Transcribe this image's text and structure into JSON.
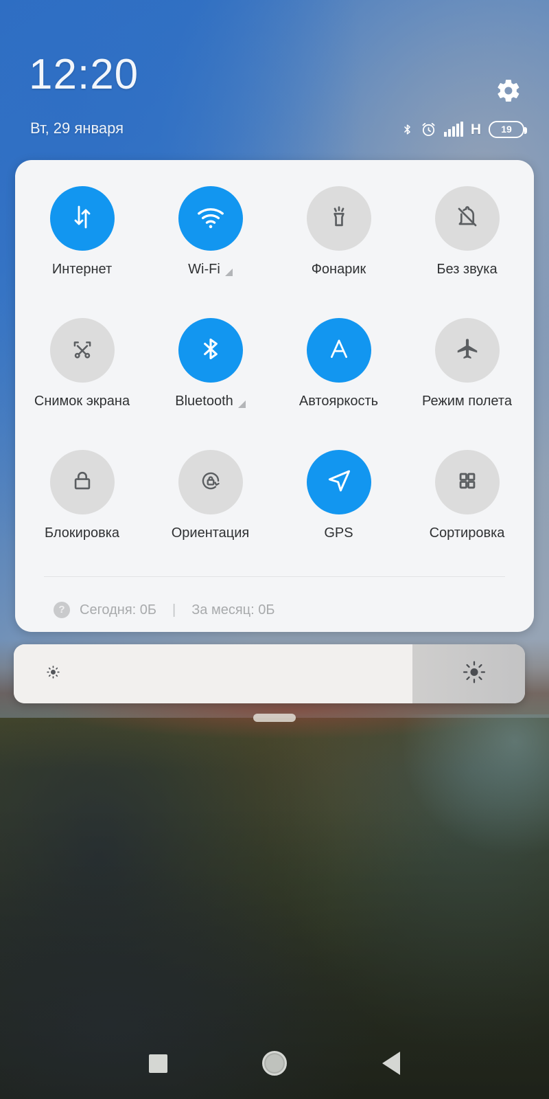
{
  "header": {
    "clock": "12:20",
    "date": "Вт, 29 января",
    "settings_icon": "gear-icon",
    "statusbar": {
      "bluetooth_icon": "bluetooth-icon",
      "alarm_icon": "alarm-clock-icon",
      "signal_icon": "signal-bars-icon",
      "network_type": "H",
      "battery_level": "19"
    }
  },
  "quick_settings": {
    "tiles": [
      {
        "label": "Интернет",
        "icon": "mobile-data-icon",
        "state": "on"
      },
      {
        "label": "Wi-Fi",
        "icon": "wifi-icon",
        "state": "on",
        "expander": true
      },
      {
        "label": "Фонарик",
        "icon": "flashlight-icon",
        "state": "off"
      },
      {
        "label": "Без звука",
        "icon": "bell-off-icon",
        "state": "off"
      },
      {
        "label": "Снимок экрана",
        "icon": "screenshot-icon",
        "state": "off"
      },
      {
        "label": "Bluetooth",
        "icon": "bluetooth-icon",
        "state": "on",
        "expander": true
      },
      {
        "label": "Автояркость",
        "icon": "auto-brightness-icon",
        "state": "on"
      },
      {
        "label": "Режим полета",
        "icon": "airplane-icon",
        "state": "off"
      },
      {
        "label": "Блокировка",
        "icon": "lock-icon",
        "state": "off"
      },
      {
        "label": "Ориентация",
        "icon": "rotation-lock-icon",
        "state": "off"
      },
      {
        "label": "GPS",
        "icon": "navigation-arrow-icon",
        "state": "on"
      },
      {
        "label": "Сортировка",
        "icon": "grid-icon",
        "state": "off"
      }
    ],
    "data_usage": {
      "help_icon": "help-icon",
      "help_glyph": "?",
      "today": "Сегодня: 0Б",
      "separator": "|",
      "month": "За месяц: 0Б"
    }
  },
  "brightness": {
    "level_percent": 78,
    "low_icon": "brightness-low-icon",
    "high_icon": "brightness-high-icon"
  },
  "drag_handle": "panel-drag-handle",
  "navbar": {
    "recents": "recents-square-icon",
    "home": "home-circle-icon",
    "back": "back-triangle-icon"
  },
  "colors": {
    "accent_on": "#1296f0",
    "tile_off": "#dcdcdc",
    "panel_bg": "#f4f5f7"
  }
}
